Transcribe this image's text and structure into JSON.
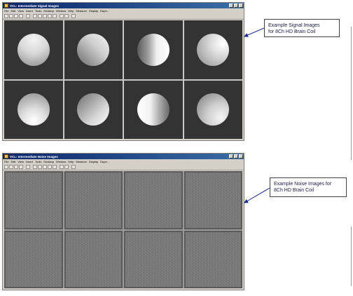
{
  "signal_window": {
    "title": "VCL: Intermediate Signal Images",
    "menu": [
      "File",
      "Edit",
      "View",
      "Insert",
      "Tools",
      "Desktop",
      "Window",
      "Help",
      "Measure",
      "Display",
      "Dupe..."
    ],
    "toolbar_icons": [
      "new-icon",
      "open-icon",
      "save-icon",
      "print-icon",
      "pointer-icon",
      "zoom-in-icon",
      "zoom-out-icon",
      "pan-icon",
      "rotate-icon",
      "data-cursor-icon",
      "colorbar-icon",
      "legend-icon",
      "square-icon"
    ]
  },
  "noise_window": {
    "title": "VCL: Intermediate Noise Images",
    "menu": [
      "File",
      "Edit",
      "View",
      "Insert",
      "Tools",
      "Desktop",
      "Window",
      "Help",
      "Measure",
      "Display",
      "Dupe..."
    ],
    "toolbar_icons": [
      "new-icon",
      "open-icon",
      "save-icon",
      "print-icon",
      "pointer-icon",
      "zoom-in-icon",
      "zoom-out-icon",
      "pan-icon",
      "rotate-icon",
      "data-cursor-icon",
      "colorbar-icon",
      "legend-icon",
      "square-icon"
    ]
  },
  "callouts": {
    "signal": [
      "Example Signal Images",
      "for 8Ch HD Brain Coil"
    ],
    "noise": [
      "Example Noise Images for",
      "8Ch HD Brain Coil"
    ]
  },
  "colors": {
    "titlebar": "#0a246a",
    "window_bg": "#d4d0c8",
    "signal_bg": "#333333",
    "arrow": "#1a2a8a"
  }
}
